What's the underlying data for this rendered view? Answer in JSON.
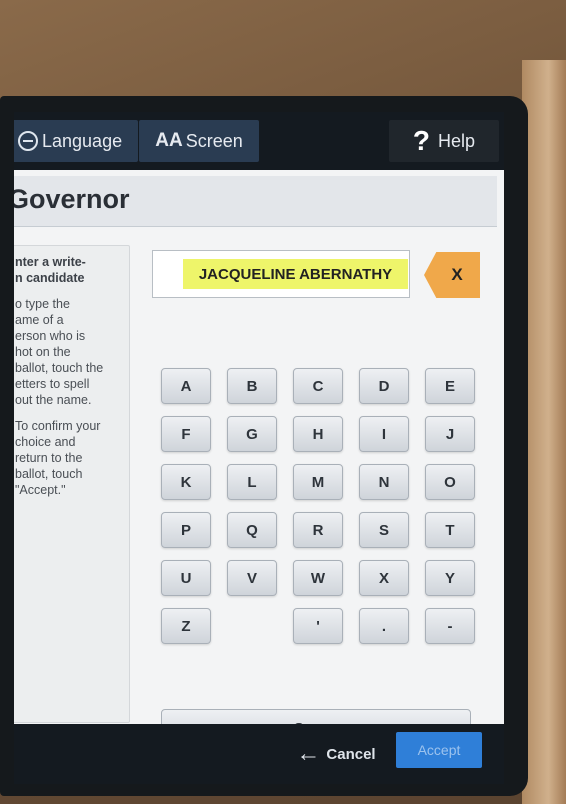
{
  "toolbar": {
    "language_label": "Language",
    "screen_label": "Screen",
    "screen_icon_text": "AA",
    "help_icon_text": "?",
    "help_label": "Help"
  },
  "contest": {
    "title": "Governor"
  },
  "instructions": {
    "heading": "nter a write-\nn candidate",
    "para1": "o type the\name of a\nerson who is\nhot on the\nballot, touch the\netters to spell\nout the name.",
    "para2": "To confirm your\nchoice and\nreturn to the\nballot, touch\n\"Accept.\""
  },
  "write_in": {
    "value": "JACQUELINE ABERNATHY",
    "backspace_label": "X"
  },
  "keyboard": {
    "rows": [
      [
        "A",
        "B",
        "C",
        "D",
        "E"
      ],
      [
        "F",
        "G",
        "H",
        "I",
        "J"
      ],
      [
        "K",
        "L",
        "M",
        "N",
        "O"
      ],
      [
        "P",
        "Q",
        "R",
        "S",
        "T"
      ],
      [
        "U",
        "V",
        "W",
        "X",
        "Y"
      ],
      [
        "Z",
        "",
        "'",
        ".",
        "-"
      ]
    ],
    "space_label": "Space"
  },
  "footer": {
    "cancel_label": "Cancel",
    "accept_label": "Accept"
  },
  "colors": {
    "highlight": "#eef56a",
    "backspace": "#f0a84a",
    "accept": "#2f7fd8",
    "topbar": "#141a20"
  }
}
